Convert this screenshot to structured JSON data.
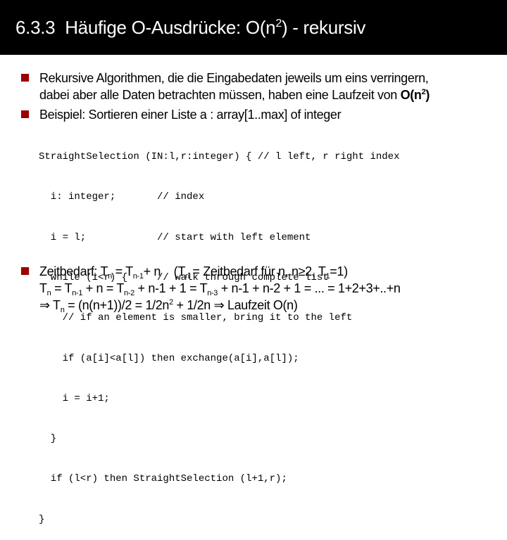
{
  "title": {
    "number": "6.3.3",
    "text_before_sup": "Häufige O-Ausdrücke: O(n",
    "sup": "2",
    "text_after_sup": ") - rekursiv"
  },
  "bullets": [
    {
      "line1": "Rekursive Algorithmen, die die Eingabedaten jeweils um eins verringern,",
      "line2_text": "dabei aber alle Daten betrachten müssen, haben eine Laufzeit von ",
      "line2_bold": "O(n",
      "line2_bold_sup": "2",
      "line2_bold_end": ")"
    },
    {
      "line1": "Beispiel: Sortieren einer Liste a : array[1..max] of integer"
    }
  ],
  "code": [
    "StraightSelection (IN:l,r:integer) { // l left, r right index",
    "  i: integer;       // index",
    "  i = l;            // start with left element",
    "  while (i<r) {     // walk through complete list",
    "    // if an element is smaller, bring it to the left",
    "    if (a[i]<a[l]) then exchange(a[i],a[l]);",
    "    i = i+1;",
    "  }",
    "  if (l<r) then StraightSelection (l+1,r);",
    "}"
  ],
  "zeitbedarf": {
    "line1": {
      "a": "Zeitbedarf: T",
      "a_sub": "n",
      "b": " = T",
      "b_sub": "n-1",
      "c": "+ n    (T",
      "c_sub": "n",
      "d": " = Zeitbedarf für n, n≥2, T",
      "d_sub": "1",
      "e": "=1)"
    },
    "line2": {
      "a": "T",
      "a_sub": "n",
      "b": " = T",
      "b_sub": "n-1",
      "c": " + n = T",
      "c_sub": "n-2",
      "d": " + n-1 + 1 = T",
      "d_sub": "n-3",
      "e": " + n-1 + n-2 + 1 = ... = 1+2+3+..+n"
    },
    "line3": {
      "a": "⇒ T",
      "a_sub": "n",
      "b": " = (n(n+1))/2 = 1/2n",
      "b_sup": "2",
      "c": " + 1/2n ⇒ Laufzeit O(n)"
    }
  },
  "colors": {
    "title_bg": "#000000",
    "title_fg": "#ffffff",
    "bullet": "#990000"
  }
}
